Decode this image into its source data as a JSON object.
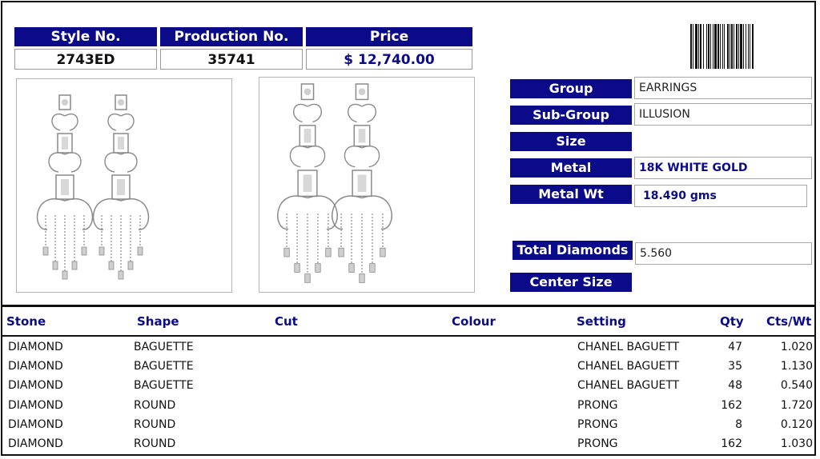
{
  "header": {
    "style_label": "Style No.",
    "style_value": "2743ED",
    "production_label": "Production No.",
    "production_value": "35741",
    "price_label": "Price",
    "price_value": "$ 12,740.00"
  },
  "details": {
    "group_label": "Group",
    "group_value": "EARRINGS",
    "subgroup_label": "Sub-Group",
    "subgroup_value": "ILLUSION",
    "size_label": "Size",
    "size_value": "",
    "metal_label": "Metal",
    "metal_value": "18K WHITE GOLD",
    "metal_wt_label": "Metal Wt",
    "metal_wt_value": "18.490 gms",
    "total_diamonds_label": "Total Diamonds",
    "total_diamonds_value": "5.560",
    "center_size_label": "Center Size"
  },
  "table": {
    "columns": [
      "Stone",
      "Shape",
      "Cut",
      "Colour",
      "Setting",
      "Qty",
      "Cts/Wt"
    ],
    "rows": [
      [
        "DIAMOND",
        "BAGUETTE",
        "",
        "",
        "CHANEL BAGUETT",
        "47",
        "1.020"
      ],
      [
        "DIAMOND",
        "BAGUETTE",
        "",
        "",
        "CHANEL BAGUETT",
        "35",
        "1.130"
      ],
      [
        "DIAMOND",
        "BAGUETTE",
        "",
        "",
        "CHANEL BAGUETT",
        "48",
        "0.540"
      ],
      [
        "DIAMOND",
        "ROUND",
        "",
        "",
        "PRONG",
        "162",
        "1.720"
      ],
      [
        "DIAMOND",
        "ROUND",
        "",
        "",
        "PRONG",
        "8",
        "0.120"
      ],
      [
        "DIAMOND",
        "ROUND",
        "",
        "",
        "PRONG",
        "162",
        "1.030"
      ]
    ]
  },
  "images": {
    "photo_left": "chandelier-earrings-pair-front-view",
    "photo_right": "chandelier-earrings-pair-angled-view",
    "barcode": "barcode-icon"
  },
  "colors": {
    "header_navy": "#0b0b8a",
    "border_grey": "#a8a8a8"
  }
}
